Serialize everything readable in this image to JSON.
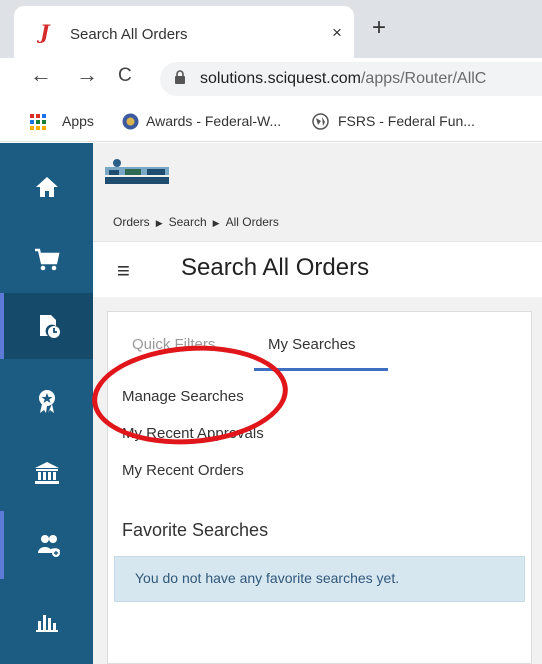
{
  "browser": {
    "tab_title": "Search All Orders",
    "tab_close": "×",
    "new_tab": "+",
    "back": "←",
    "forward": "→",
    "reload": "C",
    "url_host": "solutions.sciquest.com",
    "url_path": "/apps/Router/AllC",
    "bookmarks": [
      "Apps",
      "Awards - Federal-W...",
      "FSRS - Federal Fun..."
    ]
  },
  "sidebar": {
    "items": [
      "home-icon",
      "cart-icon",
      "orders-icon",
      "awards-icon",
      "institution-icon",
      "users-icon",
      "reports-icon"
    ],
    "active_index": 2
  },
  "app": {
    "breadcrumb": [
      "Orders",
      "Search",
      "All Orders"
    ],
    "menu_icon": "≡",
    "page_title": "Search All Orders",
    "tabs": [
      "Quick Filters",
      "My Searches"
    ],
    "active_tab": "My Searches",
    "links": [
      "Manage Searches",
      "My Recent Approvals",
      "My Recent Orders"
    ],
    "favorites_title": "Favorite Searches",
    "favorites_empty": "You do not have any favorite searches yet."
  },
  "colors": {
    "sidebar": "#1d5c82",
    "tab_underline": "#3e6fc2",
    "highlight": "#e0161b",
    "info_bg": "#d6e7f0"
  }
}
